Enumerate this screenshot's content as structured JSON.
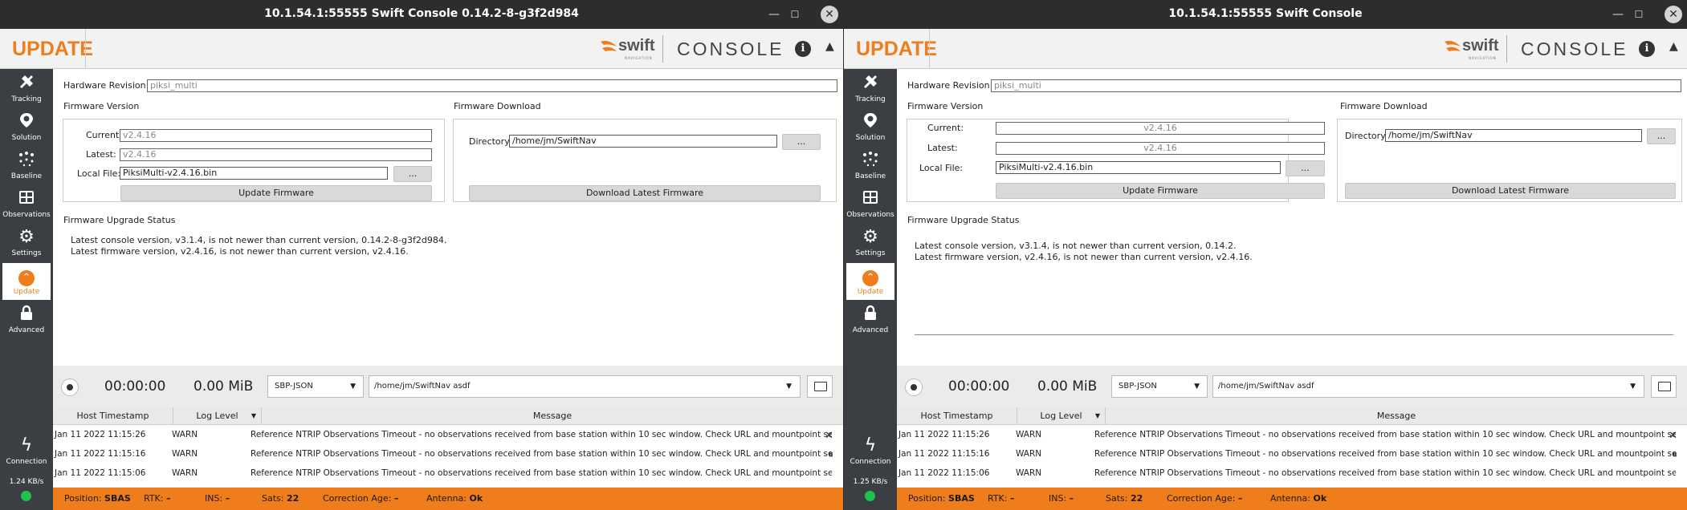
{
  "windows": [
    {
      "title": "10.1.54.1:55555 Swift Console 0.14.2-8-g3f2d984",
      "header": {
        "section_title": "UPDATE",
        "logo": "swift",
        "logo_sub": "NAVIGATION",
        "console_label": "CONSOLE",
        "info": "i",
        "collapse": "▲"
      },
      "sidebar": {
        "items": [
          {
            "label": "Tracking",
            "icon": "tracking-icon"
          },
          {
            "label": "Solution",
            "icon": "location-pin-icon"
          },
          {
            "label": "Baseline",
            "icon": "baseline-dots-icon"
          },
          {
            "label": "Observations",
            "icon": "grid-icon"
          },
          {
            "label": "Settings",
            "icon": "gears-icon"
          },
          {
            "label": "Update",
            "icon": "chevron-up-circle-icon",
            "active": true
          },
          {
            "label": "Advanced",
            "icon": "lock-icon"
          }
        ],
        "connection_label": "Connection",
        "rate": "1.24 KB/s",
        "status_color": "#1fc24a"
      },
      "update": {
        "hardware_revision_label": "Hardware Revision:",
        "hardware_revision": "piksi_multi",
        "firmware_version_title": "Firmware Version",
        "current_label": "Current:",
        "current": "v2.4.16",
        "latest_label": "Latest:",
        "latest": "v2.4.16",
        "local_file_label": "Local File:",
        "local_file": "PiksiMulti-v2.4.16.bin",
        "browse": "...",
        "update_button": "Update Firmware",
        "firmware_download_title": "Firmware Download",
        "directory_label": "Directory:",
        "directory": "/home/jm/SwiftNav",
        "download_button": "Download Latest Firmware",
        "upgrade_status_title": "Firmware Upgrade Status",
        "status_lines": [
          "Latest console version, v3.1.4, is not newer than current version, 0.14.2-8-g3f2d984.",
          "Latest firmware version, v2.4.16, is not newer than current version, v2.4.16."
        ]
      }
    },
    {
      "title": "10.1.54.1:55555 Swift Console",
      "header": {
        "section_title": "UPDATE",
        "logo": "swift",
        "logo_sub": "NAVIGATION",
        "console_label": "CONSOLE",
        "info": "i",
        "collapse": "▲"
      },
      "sidebar": {
        "items": [
          {
            "label": "Tracking",
            "icon": "tracking-icon"
          },
          {
            "label": "Solution",
            "icon": "location-pin-icon"
          },
          {
            "label": "Baseline",
            "icon": "baseline-dots-icon"
          },
          {
            "label": "Observations",
            "icon": "grid-icon"
          },
          {
            "label": "Settings",
            "icon": "gears-icon"
          },
          {
            "label": "Update",
            "icon": "chevron-up-circle-icon",
            "active": true
          },
          {
            "label": "Advanced",
            "icon": "lock-icon"
          }
        ],
        "connection_label": "Connection",
        "rate": "1.25 KB/s",
        "status_color": "#1fc24a"
      },
      "update": {
        "hardware_revision_label": "Hardware Revision:",
        "hardware_revision": "piksi_multi",
        "firmware_version_title": "Firmware Version",
        "current_label": "Current:",
        "current": "v2.4.16",
        "latest_label": "Latest:",
        "latest": "v2.4.16",
        "local_file_label": "Local File:",
        "local_file": "PiksiMulti-v2.4.16.bin",
        "browse": "...",
        "update_button": "Update Firmware",
        "firmware_download_title": "Firmware Download",
        "directory_label": "Directory:",
        "directory": "/home/jm/SwiftNav",
        "download_button": "Download Latest Firmware",
        "upgrade_status_title": "Firmware Upgrade Status",
        "status_lines": [
          "Latest console version, v3.1.4, is not newer than current version, 0.14.2.",
          "Latest firmware version, v2.4.16, is not newer than current version, v2.4.16."
        ]
      }
    }
  ],
  "recording": {
    "elapsed": "00:00:00",
    "size": "0.00 MiB",
    "format": "SBP-JSON",
    "directory": "/home/jm/SwiftNav asdf"
  },
  "log": {
    "columns": [
      "Host Timestamp",
      "Log Level",
      "Message"
    ],
    "rows": [
      {
        "timestamp": "Jan 11 2022 11:15:26",
        "level": "WARN",
        "message": "Reference NTRIP Observations Timeout - no observations received from base station within 10 sec window. Check URL and mountpoint settings, or disable"
      },
      {
        "timestamp": "Jan 11 2022 11:15:16",
        "level": "WARN",
        "message": "Reference NTRIP Observations Timeout - no observations received from base station within 10 sec window. Check URL and mountpoint settings, or disable"
      },
      {
        "timestamp": "Jan 11 2022 11:15:06",
        "level": "WARN",
        "message": "Reference NTRIP Observations Timeout - no observations received from base station within 10 sec window. Check URL and mountpoint settings, or disable"
      }
    ],
    "close": "✕",
    "pause": "⏸"
  },
  "status_bar": {
    "position_label": "Position:",
    "position": "SBAS",
    "rtk_label": "RTK:",
    "rtk": "–",
    "ins_label": "INS:",
    "ins": "–",
    "sats_label": "Sats:",
    "sats": "22",
    "correction_age_label": "Correction Age:",
    "correction_age": "–",
    "antenna_label": "Antenna:",
    "antenna": "Ok"
  },
  "colors": {
    "accent": "#f07d1b",
    "sidebar": "#3b3e42",
    "titlebar": "#2d2d2d"
  }
}
